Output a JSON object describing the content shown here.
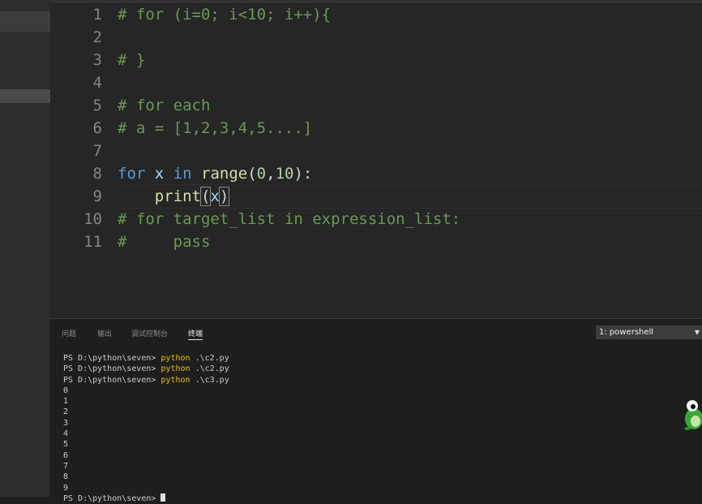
{
  "editor": {
    "lines": [
      {
        "num": "1",
        "parts": [
          {
            "t": "# for (i=0; i<10; i++){",
            "c": "cm"
          }
        ]
      },
      {
        "num": "2",
        "parts": []
      },
      {
        "num": "3",
        "parts": [
          {
            "t": "# }",
            "c": "cm"
          }
        ]
      },
      {
        "num": "4",
        "parts": []
      },
      {
        "num": "5",
        "parts": [
          {
            "t": "# for each",
            "c": "cm"
          }
        ]
      },
      {
        "num": "6",
        "parts": [
          {
            "t": "# a = [1,2,3,4,5....]",
            "c": "cm"
          }
        ]
      },
      {
        "num": "7",
        "parts": []
      },
      {
        "num": "8",
        "parts": [
          {
            "t": "for",
            "c": "kw"
          },
          {
            "t": " x ",
            "c": "var"
          },
          {
            "t": "in",
            "c": "kw"
          },
          {
            "t": " ",
            "c": ""
          },
          {
            "t": "range",
            "c": "fn"
          },
          {
            "t": "(",
            "c": ""
          },
          {
            "t": "0",
            "c": "num"
          },
          {
            "t": ",",
            "c": ""
          },
          {
            "t": "10",
            "c": "num"
          },
          {
            "t": "):",
            "c": ""
          }
        ]
      },
      {
        "num": "9",
        "parts": [
          {
            "t": "    ",
            "c": ""
          },
          {
            "t": "print",
            "c": "fn"
          },
          {
            "t": "(",
            "c": "bracket"
          },
          {
            "t": "x",
            "c": "var"
          },
          {
            "t": ")",
            "c": "bracket"
          }
        ]
      },
      {
        "num": "10",
        "parts": [
          {
            "t": "# for target_list in expression_list:",
            "c": "cm"
          }
        ]
      },
      {
        "num": "11",
        "parts": [
          {
            "t": "#     pass",
            "c": "cm"
          }
        ]
      }
    ]
  },
  "panel": {
    "tabs": [
      "问题",
      "输出",
      "调试控制台",
      "终端"
    ],
    "active_tab": "终端",
    "terminal_select": "1: powershell",
    "terminal_lines": [
      {
        "prompt": "PS D:\\python\\seven> ",
        "cmd": "python",
        "args": " .\\c2.py"
      },
      {
        "prompt": "PS D:\\python\\seven> ",
        "cmd": "python",
        "args": " .\\c2.py"
      },
      {
        "prompt": "PS D:\\python\\seven> ",
        "cmd": "python",
        "args": " .\\c3.py"
      },
      {
        "prompt": "0",
        "cmd": "",
        "args": ""
      },
      {
        "prompt": "1",
        "cmd": "",
        "args": ""
      },
      {
        "prompt": "2",
        "cmd": "",
        "args": ""
      },
      {
        "prompt": "3",
        "cmd": "",
        "args": ""
      },
      {
        "prompt": "4",
        "cmd": "",
        "args": ""
      },
      {
        "prompt": "5",
        "cmd": "",
        "args": ""
      },
      {
        "prompt": "6",
        "cmd": "",
        "args": ""
      },
      {
        "prompt": "7",
        "cmd": "",
        "args": ""
      },
      {
        "prompt": "8",
        "cmd": "",
        "args": ""
      },
      {
        "prompt": "9",
        "cmd": "",
        "args": ""
      },
      {
        "prompt": "PS D:\\python\\seven> ",
        "cmd": "",
        "args": "",
        "cursor": true
      }
    ]
  },
  "colors": {
    "comment": "#6a9955",
    "keyword": "#569cd6",
    "function": "#dcdcaa",
    "number": "#b5cea8",
    "command": "#e2c000"
  },
  "icons": {
    "mascot": "green-frog-mascot-icon",
    "dropdown": "chevron-down-icon"
  }
}
